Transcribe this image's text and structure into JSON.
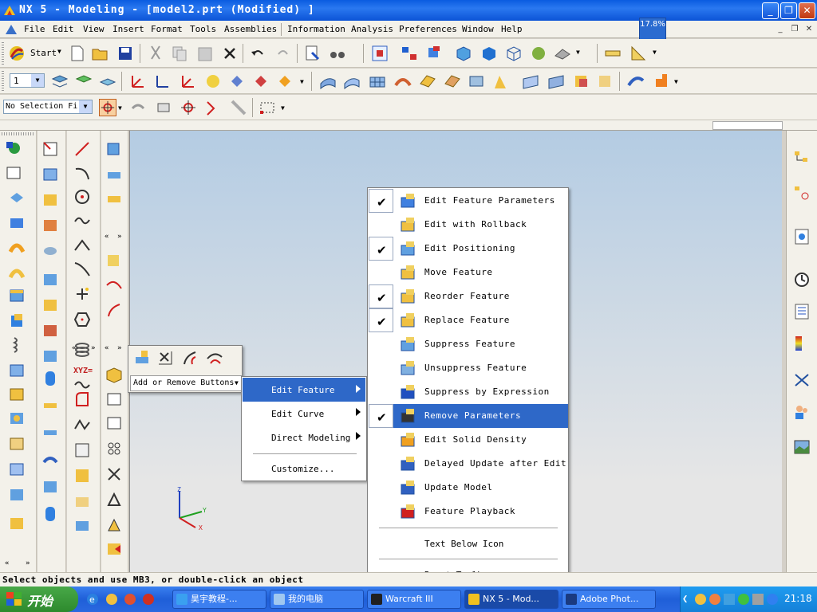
{
  "window": {
    "title": "NX 5 - Modeling - [model2.prt (Modified) ]",
    "zoom": "17.8%"
  },
  "menubar": {
    "items": [
      "File",
      "Edit",
      "View",
      "Insert",
      "Format",
      "Tools",
      "Assemblies",
      "Information",
      "Analysis",
      "Preferences",
      "Window",
      "Help"
    ]
  },
  "toolbar": {
    "start_label": "Start",
    "layer_value": "1",
    "selection_filter": "No Selection Fi"
  },
  "quick_toolbar": {
    "add_remove_label": "Add or Remove Buttons"
  },
  "submenu": {
    "items": [
      "Edit Feature",
      "Edit Curve",
      "Direct Modeling",
      "Customize..."
    ]
  },
  "feature_menu": {
    "items": [
      {
        "label": "Edit Feature Parameters",
        "checked": true
      },
      {
        "label": "Edit with Rollback",
        "checked": false
      },
      {
        "label": "Edit Positioning",
        "checked": true
      },
      {
        "label": "Move Feature",
        "checked": false
      },
      {
        "label": "Reorder Feature",
        "checked": true
      },
      {
        "label": "Replace Feature",
        "checked": true
      },
      {
        "label": "Suppress Feature",
        "checked": false
      },
      {
        "label": "Unsuppress Feature",
        "checked": false
      },
      {
        "label": "Suppress by Expression",
        "checked": false
      },
      {
        "label": "Remove Parameters",
        "checked": true
      },
      {
        "label": "Edit Solid Density",
        "checked": false
      },
      {
        "label": "Delayed Update after Edit",
        "checked": false
      },
      {
        "label": "Update Model",
        "checked": false
      },
      {
        "label": "Feature Playback",
        "checked": false
      }
    ],
    "text_below_icon": "Text Below Icon",
    "reset_toolbar": "Reset Toolbar"
  },
  "axes": {
    "x": "X",
    "y": "Y",
    "z": "Z"
  },
  "statusbar": {
    "message": "Select objects and use MB3, or double-click an object"
  },
  "taskbar": {
    "start": "开始",
    "tasks": [
      "昊宇教程-...",
      "我的电脑",
      "Warcraft III",
      "NX 5 - Mod...",
      "Adobe Phot..."
    ],
    "clock": "21:18"
  },
  "colors": {
    "accent": "#2e68c8",
    "titlebar": "#0a5ce0",
    "viewport_top": "#b4cce3"
  }
}
